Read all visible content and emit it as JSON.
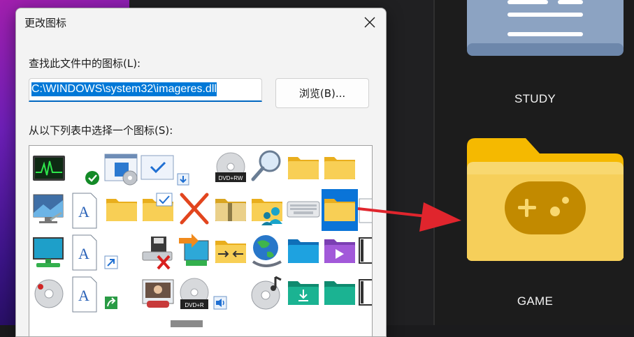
{
  "dialog": {
    "title": "更改图标",
    "find_label": "查找此文件中的图标(L):",
    "file_path": "C:\\WINDOWS\\system32\\imageres.dll",
    "browse_label": "浏览(B)...",
    "select_label": "从以下列表中选择一个图标(S):"
  },
  "desktop": {
    "folders": [
      {
        "name": "STUDY",
        "icon": "study-folder-icon"
      },
      {
        "name": "GAME",
        "icon": "game-folder-icon"
      }
    ]
  },
  "icons": {
    "rows": [
      [
        "performance-monitor-icon",
        "green-check-icon",
        "control-panel-icon",
        "checkbox-window-icon",
        "dvd-rw-icon",
        "magnifier-icon",
        "folder-icon",
        "folder-icon"
      ],
      [
        "display-settings-icon",
        "font-document-icon",
        "folder-icon",
        "folder-checked-icon",
        "red-x-icon",
        "zip-folder-icon",
        "user-folder-icon",
        "keyboard-icon",
        "folder-icon"
      ],
      [
        "monitor-icon",
        "font-document-icon",
        "shortcut-overlay-icon",
        "disconnected-drive-icon",
        "network-transfer-icon",
        "compress-folder-icon",
        "globe-network-icon",
        "desktop-folder-icon",
        "videos-folder-icon",
        "film-strip-icon"
      ],
      [
        "cd-audio-icon",
        "font-document-icon",
        "share-overlay-icon",
        "photo-editor-icon",
        "dvd-r-icon",
        "speaker-icon",
        "cd-music-icon",
        "downloads-folder-icon",
        "green-folder-icon",
        "film-strip-icon"
      ]
    ],
    "badges": {
      "dvd_rw": "DVD+RW",
      "dvd_r": "DVD+R",
      "font": "A"
    }
  },
  "colors": {
    "accent": "#0078d7",
    "folder_yellow": "#f8c93a",
    "game_folder": "#f5cb45",
    "arrow": "#e0252d"
  }
}
